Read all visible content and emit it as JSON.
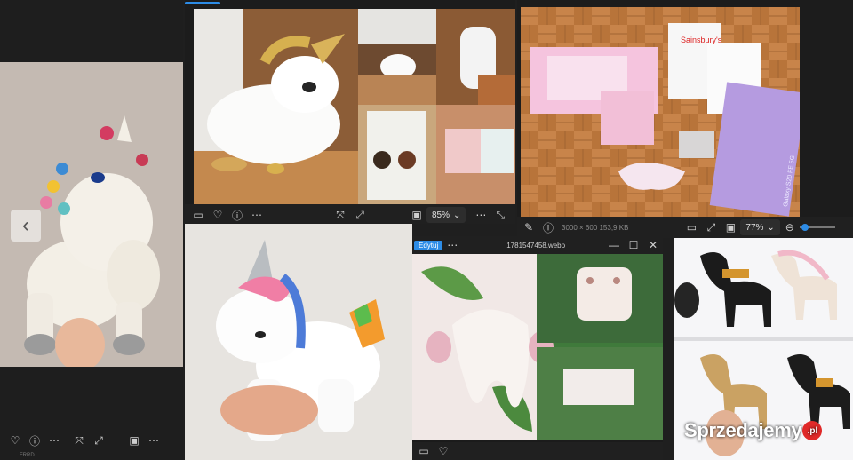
{
  "watermark": {
    "text_main": "Sprzedajemy",
    "text_suffix": ".pl"
  },
  "panel_left": {
    "toolbar_icons": [
      "heart-icon",
      "info-icon",
      "more-icon",
      "fit-icon",
      "fullscreen-icon",
      "screen-icon",
      "more-icon"
    ],
    "nav_prev": "‹",
    "footer_note": "FRRD"
  },
  "panel_top_center": {
    "zoom_value": "85%",
    "toolbar_icons": [
      "monitor-icon",
      "heart-icon",
      "info-icon",
      "more-icon",
      "fit-icon",
      "expand-icon",
      "screen-icon",
      "more-icon",
      "fullscreen-icon"
    ],
    "book_title": "",
    "progress_bar_fraction": 0.1
  },
  "panel_top_right": {
    "meta": "3000 × 600   153,9 KB",
    "zoom_value": "77%",
    "stamp_text": "Sainsbury's",
    "envelope_text": "Galaxy S20 FE 5G"
  },
  "panel_bottom_center": {
    "edit_label": "Edytuj",
    "file_name": "1781547458.webp",
    "window_controls": [
      "—",
      "☐",
      "✕"
    ]
  },
  "colors": {
    "toolbar_bg": "#202020",
    "accent": "#2d8ce6",
    "chrome": "#1c1c1c"
  }
}
